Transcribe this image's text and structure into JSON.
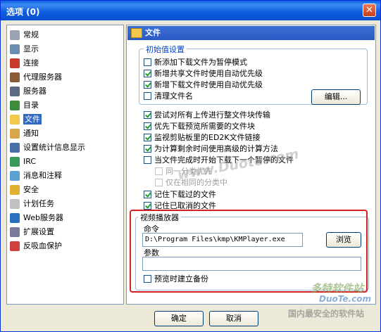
{
  "window": {
    "title": "选项 (0)",
    "close_glyph": "✕"
  },
  "sidebar": {
    "items": [
      {
        "label": "常规",
        "icon": "general-icon",
        "color": "#9aa4b0"
      },
      {
        "label": "显示",
        "icon": "display-icon",
        "color": "#6a8caf"
      },
      {
        "label": "连接",
        "icon": "connection-icon",
        "color": "#c83a2a"
      },
      {
        "label": "代理服务器",
        "icon": "proxy-icon",
        "color": "#8a5a3a"
      },
      {
        "label": "服务器",
        "icon": "server-icon",
        "color": "#5c6c80"
      },
      {
        "label": "目录",
        "icon": "folder-icon",
        "color": "#3c8c3c"
      },
      {
        "label": "文件",
        "icon": "files-icon",
        "color": "#f2c94c",
        "selected": true
      },
      {
        "label": "通知",
        "icon": "notification-icon",
        "color": "#d9a54a"
      },
      {
        "label": "设置统计信息显示",
        "icon": "statistics-icon",
        "color": "#4a6ea8"
      },
      {
        "label": "IRC",
        "icon": "irc-icon",
        "color": "#3a9a5a"
      },
      {
        "label": "消息和注释",
        "icon": "messages-icon",
        "color": "#5aa0d0"
      },
      {
        "label": "安全",
        "icon": "security-icon",
        "color": "#e0b030"
      },
      {
        "label": "计划任务",
        "icon": "scheduler-icon",
        "color": "#c0c0c0"
      },
      {
        "label": "Web服务器",
        "icon": "web-server-icon",
        "color": "#2a70c0"
      },
      {
        "label": "扩展设置",
        "icon": "extended-settings-icon",
        "color": "#7a7a9a"
      },
      {
        "label": "反吸血保护",
        "icon": "anti-leech-icon",
        "color": "#d04040"
      }
    ]
  },
  "panel": {
    "header": "文件",
    "defaults_group": {
      "title": "初始值设置",
      "options": [
        {
          "label": "新添加下载文件为暂停模式",
          "checked": false
        },
        {
          "label": "新增共享文件时使用自动优先级",
          "checked": true
        },
        {
          "label": "新增下载文件时使用自动优先级",
          "checked": true
        },
        {
          "label": "清理文件名",
          "checked": false
        }
      ],
      "edit_button": "编辑..."
    },
    "options": [
      {
        "label": "尝试对所有上传进行整文件块传输",
        "checked": true
      },
      {
        "label": "优先下载预览所需要的文件块",
        "checked": true
      },
      {
        "label": "监视剪贴板里的ED2K文件链接",
        "checked": true
      },
      {
        "label": "为计算剩余时间使用高级的计算方法",
        "checked": true
      },
      {
        "label": "当文件完成时开始下载下一个暂停的文件",
        "checked": false
      }
    ],
    "sub_options": [
      {
        "label": "同一分类优先",
        "checked": false,
        "disabled": true
      },
      {
        "label": "仅在相同的分类中",
        "checked": false,
        "disabled": true
      }
    ],
    "options2": [
      {
        "label": "记住下载过的文件",
        "checked": true
      },
      {
        "label": "记住已取消的文件",
        "checked": true
      }
    ],
    "video_group": {
      "title": "视频播放器",
      "command_label": "命令",
      "command_value": "D:\\Program Files\\kmp\\KMPlayer.exe",
      "browse_button": "浏览",
      "params_label": "参数",
      "params_value": "",
      "backup_label": "预览时建立备份",
      "backup_checked": false
    }
  },
  "footer": {
    "ok": "确定",
    "cancel": "取消"
  },
  "watermarks": {
    "center": "www.Duote.com",
    "corner_brand": "多特软件站",
    "corner_url": "DuoTe.com",
    "corner_slogan": "国内最安全的软件站"
  }
}
